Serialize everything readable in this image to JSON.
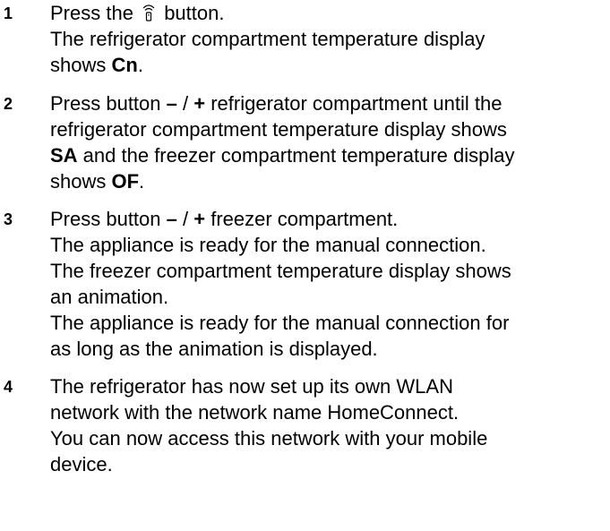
{
  "steps": [
    {
      "number": "1",
      "line1_pre": "Press the",
      "icon": "remote-start-icon",
      "line1_post": "button.",
      "line2": "The refrigerator compartment temperature display",
      "line3_pre": "shows",
      "line3_bold": "Cn",
      "line3_post": "."
    },
    {
      "number": "2",
      "line1_pre": "Press button",
      "line1_bold1": "–",
      "line1_mid": " / ",
      "line1_bold2": "+",
      "line1_post": " refrigerator compartment until the",
      "line2": "refrigerator compartment temperature display shows",
      "line3_bold": "SA",
      "line3_post": " and the freezer compartment temperature display",
      "line4_pre": "shows",
      "line4_bold": "OF",
      "line4_post": "."
    },
    {
      "number": "3",
      "line1_pre": "Press button",
      "line1_bold1": "–",
      "line1_mid": " / ",
      "line1_bold2": "+",
      "line1_post": " freezer compartment.",
      "line2": "The appliance is ready for the manual connection.",
      "line3": "The freezer compartment temperature display shows",
      "line4": "an animation.",
      "line5": "The appliance is ready for the manual connection for",
      "line6": "as long as the animation is displayed."
    },
    {
      "number": "4",
      "line1": "The refrigerator has now set up its own WLAN",
      "line2": "network with the network name HomeConnect.",
      "line3": "You can now access this network with your mobile",
      "line4": "device."
    }
  ]
}
